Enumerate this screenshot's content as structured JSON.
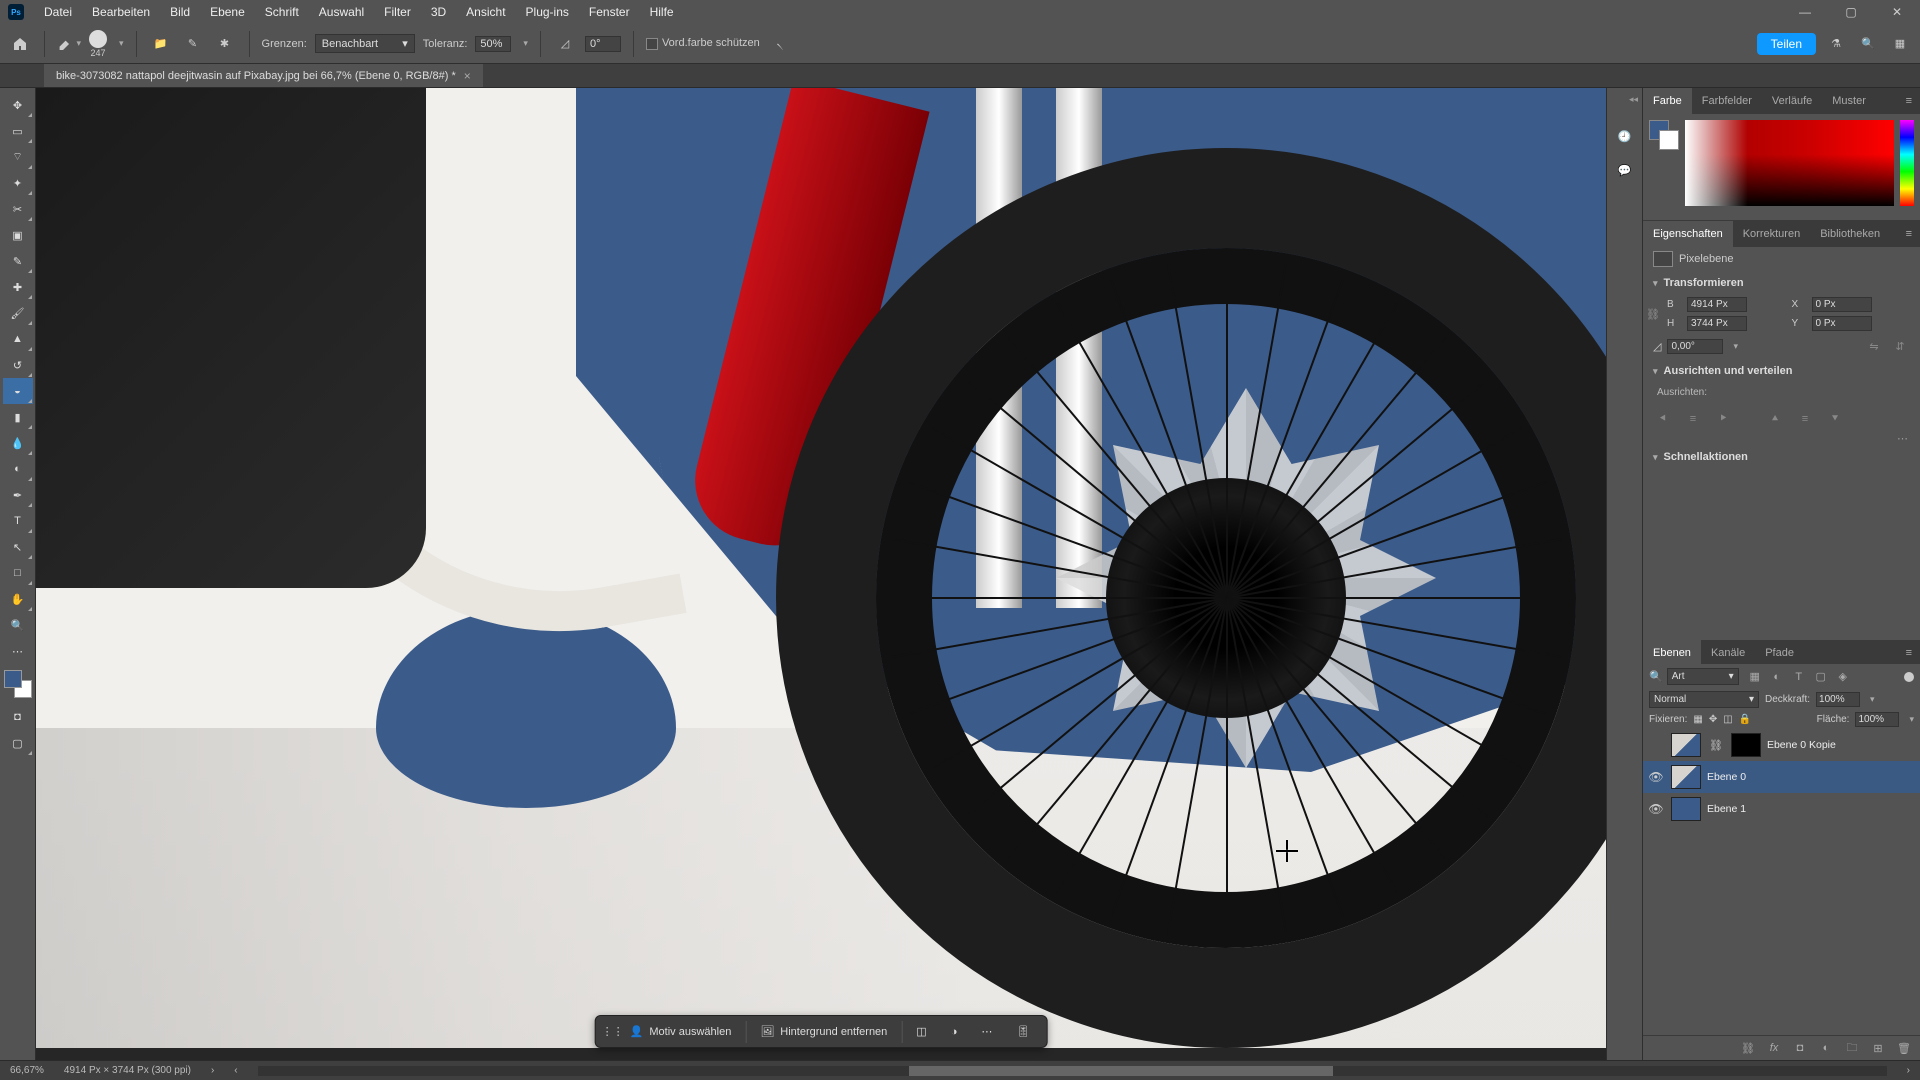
{
  "menu": {
    "items": [
      "Datei",
      "Bearbeiten",
      "Bild",
      "Ebene",
      "Schrift",
      "Auswahl",
      "Filter",
      "3D",
      "Ansicht",
      "Plug-ins",
      "Fenster",
      "Hilfe"
    ]
  },
  "options": {
    "brush_size": "247",
    "limits_lbl": "Grenzen:",
    "limits_val": "Benachbart",
    "tolerance_lbl": "Toleranz:",
    "tolerance_val": "50%",
    "angle_val": "0°",
    "protect_fg": "Vord.farbe schützen",
    "share": "Teilen"
  },
  "doc_tab": "bike-3073082 nattapol deejitwasin auf Pixabay.jpg bei 66,7% (Ebene 0, RGB/8#) *",
  "color_tabs": [
    "Farbe",
    "Farbfelder",
    "Verläufe",
    "Muster"
  ],
  "prop_tabs": [
    "Eigenschaften",
    "Korrekturen",
    "Bibliotheken"
  ],
  "props": {
    "pixel_layer": "Pixelebene",
    "transform_hdr": "Transformieren",
    "B": "B",
    "H": "H",
    "X": "X",
    "Y": "Y",
    "w_val": "4914 Px",
    "h_val": "3744 Px",
    "x_val": "0 Px",
    "y_val": "0 Px",
    "angle": "0,00°",
    "align_hdr": "Ausrichten und verteilen",
    "align_lbl": "Ausrichten:",
    "quick_hdr": "Schnellaktionen"
  },
  "layer_tabs": [
    "Ebenen",
    "Kanäle",
    "Pfade"
  ],
  "layers": {
    "filter_kind": "Art",
    "blend_mode": "Normal",
    "opacity_lbl": "Deckkraft:",
    "opacity_val": "100%",
    "lock_lbl": "Fixieren:",
    "fill_lbl": "Fläche:",
    "fill_val": "100%",
    "items": [
      {
        "name": "Ebene 0 Kopie",
        "visible": false,
        "masked": true
      },
      {
        "name": "Ebene 0",
        "visible": true,
        "selected": true
      },
      {
        "name": "Ebene 1",
        "visible": true
      }
    ]
  },
  "ctx": {
    "select_subject": "Motiv auswählen",
    "remove_bg": "Hintergrund entfernen"
  },
  "status": {
    "zoom": "66,67%",
    "doc": "4914 Px × 3744 Px (300 ppi)"
  }
}
